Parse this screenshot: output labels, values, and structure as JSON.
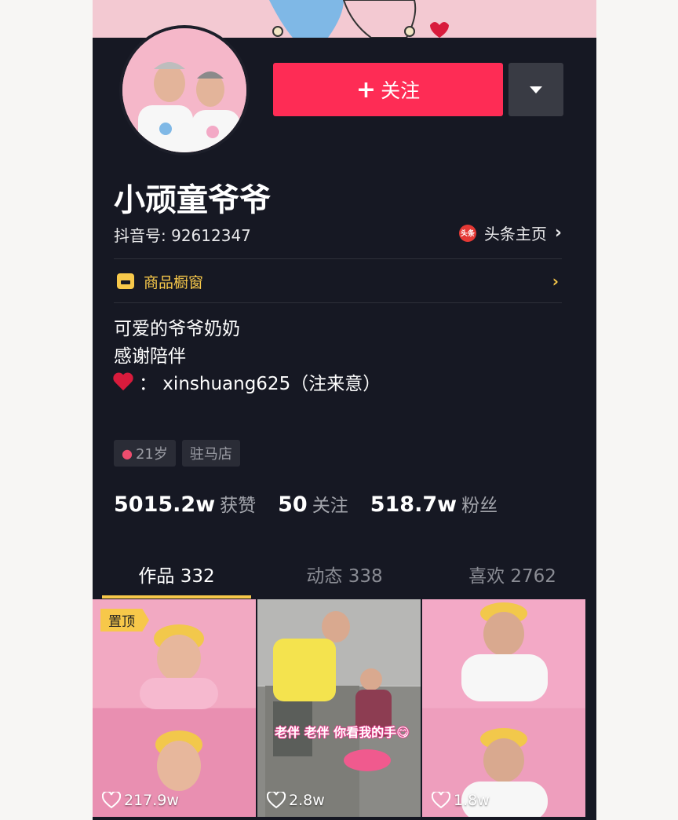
{
  "profile": {
    "nickname": "小顽童爷爷",
    "douyin_id": "抖音号: 92612347",
    "toutiao_badge": "头条",
    "toutiao_label": "头条主页"
  },
  "actions": {
    "follow_label": "关注",
    "follow_plus": "+"
  },
  "shop": {
    "label": "商品橱窗"
  },
  "bio": {
    "line1": "可爱的爷爷奶奶",
    "line2": "感谢陪伴",
    "line3": "：  xinshuang625（注来意）"
  },
  "tags": {
    "age": "21岁",
    "location": "驻马店"
  },
  "stats": {
    "likes_num": "5015.2w",
    "likes_label": "获赞",
    "following_num": "50",
    "following_label": "关注",
    "fans_num": "518.7w",
    "fans_label": "粉丝"
  },
  "tabs": [
    {
      "label": "作品 332"
    },
    {
      "label": "动态 338"
    },
    {
      "label": "喜欢 2762"
    }
  ],
  "videos": [
    {
      "likes": "217.9w",
      "pinned_label": "置顶"
    },
    {
      "likes": "2.8w",
      "caption": "老伴 老伴 你看我的手😋"
    },
    {
      "likes": "1.8w"
    }
  ],
  "colors": {
    "background": "#161823",
    "follow": "#fe2c55",
    "accent": "#f7c84a"
  }
}
